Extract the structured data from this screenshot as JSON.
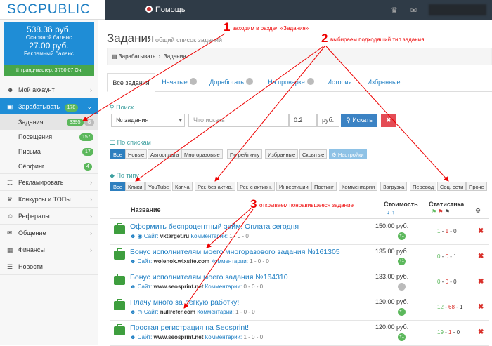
{
  "brand": {
    "logo": "SOCPUBLIC"
  },
  "topbar": {
    "help_label": "Помощь",
    "bell_icon": "bell-icon",
    "chat_icon": "chat-icon"
  },
  "sidebar": {
    "main_balance": "538.36 руб.",
    "main_balance_label": "Основной баланс",
    "ad_balance": "27.00 руб.",
    "ad_balance_label": "Рекламный баланс",
    "status": "гранд-мастер, 3'750.07 Оч.",
    "items": [
      {
        "label": "Мой аккаунт",
        "icon": "user-icon"
      },
      {
        "label": "Зарабатывать",
        "icon": "briefcase-icon",
        "count": "178"
      },
      {
        "label": "Рекламировать",
        "icon": "megaphone-icon"
      },
      {
        "label": "Конкурсы и ТОПы",
        "icon": "trophy-icon"
      },
      {
        "label": "Рефералы",
        "icon": "users-icon"
      },
      {
        "label": "Общение",
        "icon": "comments-icon"
      },
      {
        "label": "Финансы",
        "icon": "money-icon"
      },
      {
        "label": "Новости",
        "icon": "news-icon"
      }
    ],
    "sub": [
      {
        "label": "Задания",
        "count": "3395"
      },
      {
        "label": "Посещения",
        "count": "157"
      },
      {
        "label": "Письма",
        "count": "17"
      },
      {
        "label": "Сёрфинг",
        "count": "4"
      }
    ]
  },
  "page": {
    "title": "Задания",
    "subtitle": "общий список заданий",
    "breadcrumb": {
      "first": "Зарабатывать",
      "current": "Задания"
    }
  },
  "tabs": [
    {
      "label": "Все задания"
    },
    {
      "label": "Начатые"
    },
    {
      "label": "Доработать"
    },
    {
      "label": "На проверке"
    },
    {
      "label": "История"
    },
    {
      "label": "Избранные"
    }
  ],
  "search": {
    "label": "Поиск",
    "select_value": "№ задания",
    "query_placeholder": "Что искать",
    "amount": "0.2",
    "unit": "руб.",
    "search_button": "Искать",
    "clear_button": "✖"
  },
  "lists": {
    "label": "По спискам",
    "items": [
      "Все",
      "Новые",
      "Автооплата",
      "Многоразовые",
      "По рейтингу",
      "Избранные",
      "Скрытые",
      "Настройки"
    ]
  },
  "types": {
    "label": "По типу",
    "items": [
      "Все",
      "Клики",
      "YouTube",
      "Капча",
      "Рег. без актив.",
      "Рег. с активн.",
      "Инвестиции",
      "Постинг",
      "Комментарии",
      "Загрузка",
      "Перевод",
      "Соц. сети",
      "Проче"
    ]
  },
  "table": {
    "col_name": "Название",
    "col_price": "Стоимость",
    "col_stats": "Статистика",
    "rows": [
      {
        "title": "Оформить беспроцентный займ. Оплата сегодня",
        "site": "vktarget.ru",
        "comments": "1 - 0 - 0",
        "price": "150.00 руб.",
        "badge": "+1",
        "badge_gray": false,
        "s1": "1",
        "s2": "1",
        "s3": "0"
      },
      {
        "title": "Бонус исполнителям моего многоразового задания №161305",
        "site": "wolenok.wixsite.com",
        "comments": "1 - 0 - 0",
        "price": "135.00 руб.",
        "badge": "+1",
        "badge_gray": false,
        "s1": "0",
        "s2": "0",
        "s3": "1"
      },
      {
        "title": "Бонус исполнителям моего задания №164310",
        "site": "www.seosprint.net",
        "comments": "0 - 0 - 0",
        "price": "133.00 руб.",
        "badge": "",
        "badge_gray": true,
        "s1": "0",
        "s2": "0",
        "s3": "0"
      },
      {
        "title": "Плачу много за легкую работку!",
        "site": "nullrefer.com",
        "comments": "1 - 0 - 0",
        "price": "120.00 руб.",
        "badge": "+1",
        "badge_gray": false,
        "s1": "12",
        "s2": "68",
        "s3": "1"
      },
      {
        "title": "Простая регистрация на Seosprint!",
        "site": "www.seosprint.net",
        "comments": "1 - 0 - 0",
        "price": "120.00 руб.",
        "badge": "+1",
        "badge_gray": false,
        "s1": "19",
        "s2": "1",
        "s3": "0"
      }
    ],
    "site_prefix": "Сайт:",
    "comments_prefix": "Комментарии:"
  },
  "annotations": {
    "n1": "1",
    "t1": "заходим в раздел «Задания»",
    "n2": "2",
    "t2": "выбираем подходящий тип задания",
    "n3": "3",
    "t3": "открываем понравившееся задание"
  },
  "colors": {
    "accent": "#1f8dd6",
    "green": "#5cb85c",
    "red": "#d9302a",
    "annotation": "#ee0000"
  }
}
